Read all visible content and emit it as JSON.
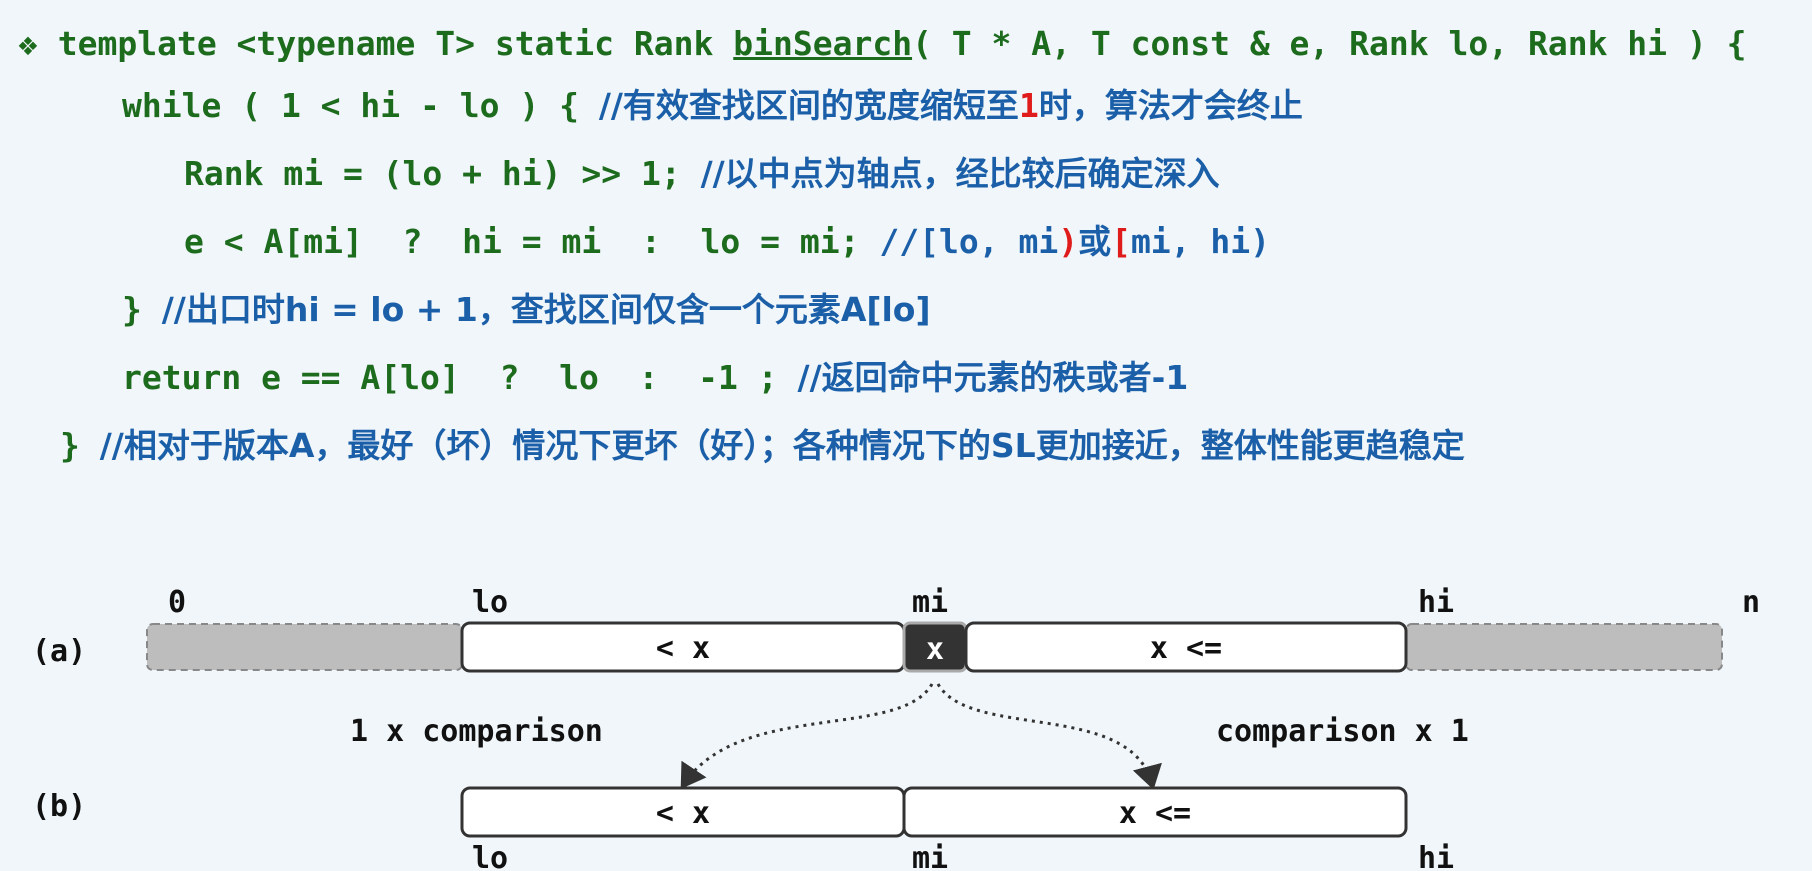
{
  "code": {
    "line1": {
      "bullet": "❖",
      "pre": " template <typename T> static Rank ",
      "fn": "binSearch",
      "post": "( T * A, T const & e, Rank lo, Rank hi ) {"
    },
    "line2": {
      "code": "while ( 1 < hi - lo ) { ",
      "c1": "//有效查找区间的宽度缩短至",
      "c2": "1",
      "c3": "时，算法才会终止"
    },
    "line3": {
      "code": "Rank mi = (lo + hi) >> 1; ",
      "c1": "//以中点为轴点，经比较后确定深入"
    },
    "line4": {
      "code": "e < A[mi]  ?  hi = mi  :  lo = mi; ",
      "c1": "//[lo, mi",
      "c2": ")",
      "c3": "或",
      "c4": "[",
      "c5": "mi, hi)"
    },
    "line5": {
      "code": "} ",
      "c1": "//出口时hi = lo + 1，查找区间仅含一个元素A[lo]"
    },
    "line6": {
      "code": "return e == A[lo]  ?  lo  :  -1 ; ",
      "c1": "//返回命中元素的秩或者-1"
    },
    "line7": {
      "code": "} ",
      "c1": "//相对于版本A，最好（坏）情况下更坏（好）；各种情况下的SL更加接近，整体性能更趋稳定"
    }
  },
  "diagram": {
    "top_labels": {
      "zero": "0",
      "lo": "lo",
      "mi": "mi",
      "hi": "hi",
      "n": "n"
    },
    "label_a": "(a)",
    "label_b": "(b)",
    "a_left": "< x",
    "a_mid": "x",
    "a_right": "x <=",
    "left_caption": "1 x comparison",
    "right_caption": "comparison x 1",
    "b_left": "< x",
    "b_right": "x <=",
    "bottom_labels": {
      "lo": "lo",
      "mi": "mi",
      "hi": "hi"
    },
    "colors": {
      "gray_box": "#bdbdbd",
      "mid_box": "#333333",
      "outline": "#333333"
    }
  }
}
